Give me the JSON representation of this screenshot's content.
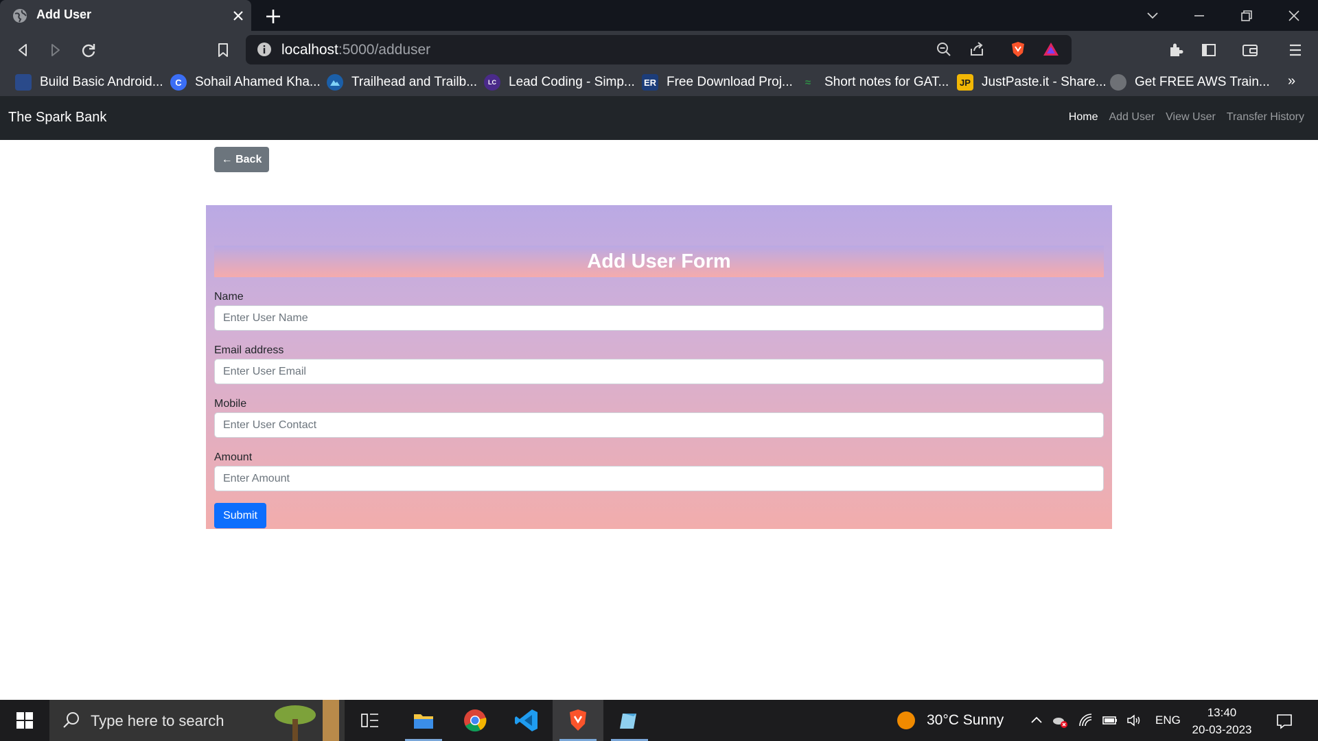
{
  "browser": {
    "tab": {
      "title": "Add User"
    },
    "address": {
      "host": "localhost",
      "path": ":5000/adduser"
    },
    "bookmarks": [
      {
        "label": "Build Basic Android...",
        "icon": "android-bookmark-icon",
        "color": "#2a4a8a"
      },
      {
        "label": "Sohail Ahamed Kha...",
        "icon": "c-logo-bookmark-icon",
        "color": "#3b6ef5"
      },
      {
        "label": "Trailhead and Trailb...",
        "icon": "trailhead-bookmark-icon",
        "color": "#1b5fa8"
      },
      {
        "label": "Lead Coding - Simp...",
        "icon": "lead-coding-bookmark-icon",
        "color": "#4a2a8a"
      },
      {
        "label": "Free Download Proj...",
        "icon": "er-bookmark-icon",
        "color": "#1c3d7a"
      },
      {
        "label": "Short notes for GAT...",
        "icon": "gfg-bookmark-icon",
        "color": "#2f8d46"
      },
      {
        "label": "JustPaste.it - Share...",
        "icon": "jp-bookmark-icon",
        "color": "#f2b705"
      },
      {
        "label": "Get FREE AWS Train...",
        "icon": "globe-bookmark-icon",
        "color": "#6e7176"
      }
    ]
  },
  "site": {
    "brand": "The Spark Bank",
    "nav": [
      {
        "label": "Home",
        "active": true
      },
      {
        "label": "Add User",
        "active": false
      },
      {
        "label": "View User",
        "active": false
      },
      {
        "label": "Transfer History",
        "active": false
      }
    ],
    "back_label": "← Back",
    "form": {
      "title": "Add User Form",
      "fields": [
        {
          "label": "Name",
          "placeholder": "Enter User Name"
        },
        {
          "label": "Email address",
          "placeholder": "Enter User Email"
        },
        {
          "label": "Mobile",
          "placeholder": "Enter User Contact"
        },
        {
          "label": "Amount",
          "placeholder": "Enter Amount"
        }
      ],
      "submit_label": "Submit"
    }
  },
  "taskbar": {
    "search_placeholder": "Type here to search",
    "weather": "30°C  Sunny",
    "language": "ENG",
    "time": "13:40",
    "date": "20-03-2023"
  },
  "colors": {
    "primary": "#0d6efd",
    "secondary": "#6c757d",
    "navbar": "#212529",
    "form_gradient_top": "#baa9e4",
    "form_gradient_bottom": "#f2adac"
  }
}
